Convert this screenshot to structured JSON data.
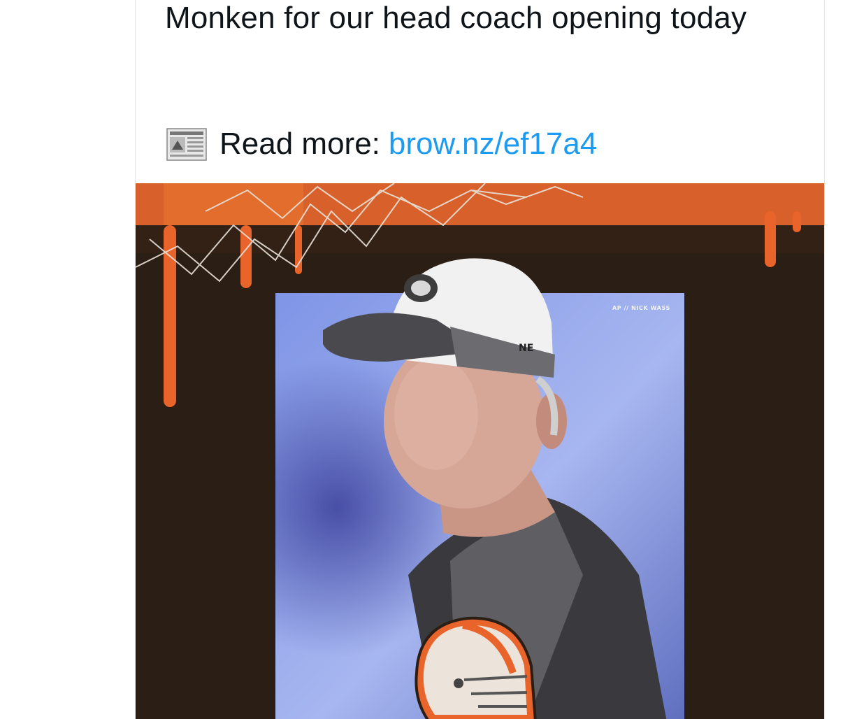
{
  "tweet": {
    "text": "Monken for our head coach opening today",
    "read_more_label": "Read more:",
    "link_text": "brow.nz/ef17a4"
  },
  "media": {
    "photo_credit": "AP // NICK WASS",
    "icons": {
      "news": "newspaper-icon",
      "logo": "helmet-logo-icon"
    }
  },
  "colors": {
    "link": "#1d9bf0",
    "text": "#0f1419",
    "brand_orange": "#e8642a",
    "brand_brown": "#2b1e15",
    "photo_sky": "#8fa3e6"
  }
}
